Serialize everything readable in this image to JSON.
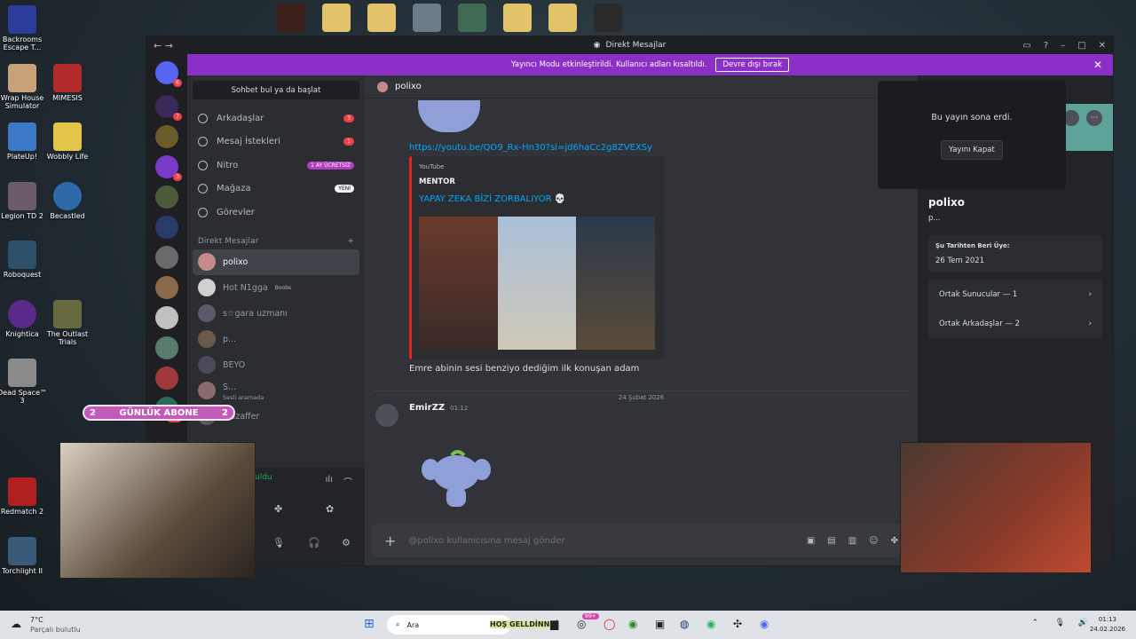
{
  "desktop": {
    "left_icons": [
      {
        "label": "Backrooms Escape T..."
      },
      {
        "label": "Wrap House Simulator"
      },
      {
        "label": "MIMESIS"
      },
      {
        "label": "PlateUp!"
      },
      {
        "label": "Wobbly Life"
      },
      {
        "label": "Legion TD 2"
      },
      {
        "label": "Becastled"
      },
      {
        "label": "Roboquest"
      },
      {
        "label": "Knightica"
      },
      {
        "label": "The Outlast Trials"
      },
      {
        "label": "Dead Space™ 3"
      },
      {
        "label": "Redmatch 2"
      },
      {
        "label": "Torchlight II"
      }
    ]
  },
  "window": {
    "title": "Direkt Mesajlar"
  },
  "banner": {
    "text": "Yayıncı Modu etkinleştirildi. Kullanıcı adları kısaltıldı.",
    "button": "Devre dışı bırak"
  },
  "servers": {
    "badges": [
      "6",
      "7",
      "3",
      "323"
    ]
  },
  "dm_sidebar": {
    "find_button": "Sohbet bul ya da başlat",
    "nav": [
      {
        "label": "Arkadaşlar",
        "pill": "3"
      },
      {
        "label": "Mesaj İstekleri",
        "pill": "1"
      },
      {
        "label": "Nitro",
        "pill": "1 AY ÜCRETSİZ"
      },
      {
        "label": "Mağaza",
        "pill": "YENİ"
      },
      {
        "label": "Görevler",
        "pill": ""
      }
    ],
    "dm_header": "Direkt Mesajlar",
    "dms": [
      {
        "name": "polixo",
        "sub": ""
      },
      {
        "name": "Hot N1gga",
        "sub": "Boobs"
      },
      {
        "name": "s☆gara uzmanı",
        "sub": ""
      },
      {
        "name": "p...",
        "sub": ""
      },
      {
        "name": "BEYO",
        "sub": ""
      },
      {
        "name": "S...",
        "sub": "Sesli aramada"
      },
      {
        "name": "Muzaffer",
        "sub": ""
      }
    ],
    "user_panel": {
      "status": "uldu"
    }
  },
  "chat": {
    "header_name": "polixo",
    "link": "https://youtu.be/QO9_Rx-Hn30?si=jd6haCc2g8ZVEXSy",
    "embed": {
      "provider": "YouTube",
      "author": "MENTOR",
      "title": "YAPAY ZEKA BİZİ ZORBALIYOR 💀"
    },
    "message_text": "Emre abinin sesi benziyo dediğim ilk konuşan adam",
    "date_divider": "24 Şubat 2026",
    "second_author": "EmirZZ",
    "second_time": "01:12",
    "input_placeholder": "@polixo kullanıcısına mesaj gönder"
  },
  "stream_ended": {
    "text": "Bu yayın sona erdi.",
    "button": "Yayını Kapat"
  },
  "profile": {
    "name": "polixo",
    "short": "p...",
    "member_since_label": "Şu Tarihten Beri Üye:",
    "member_since": "26 Tem 2021",
    "mutual_servers": "Ortak Sunucular — 1",
    "mutual_friends": "Ortak Arkadaşlar — 2"
  },
  "overlay": {
    "left": "2",
    "label": "GÜNLÜK ABONE",
    "right": "2"
  },
  "taskbar": {
    "weather_temp": "7°C",
    "weather_desc": "Parçalı bulutlu",
    "search": "Ara",
    "ticker": "HOŞ GELLDİNNNİ",
    "badge": "99+",
    "time": "01:13",
    "date": "24.02.2026"
  },
  "colors": {
    "accent": "#5865f2",
    "banner": "#8c2fc7",
    "embed_border": "#e02424",
    "link": "#00a8fc"
  }
}
